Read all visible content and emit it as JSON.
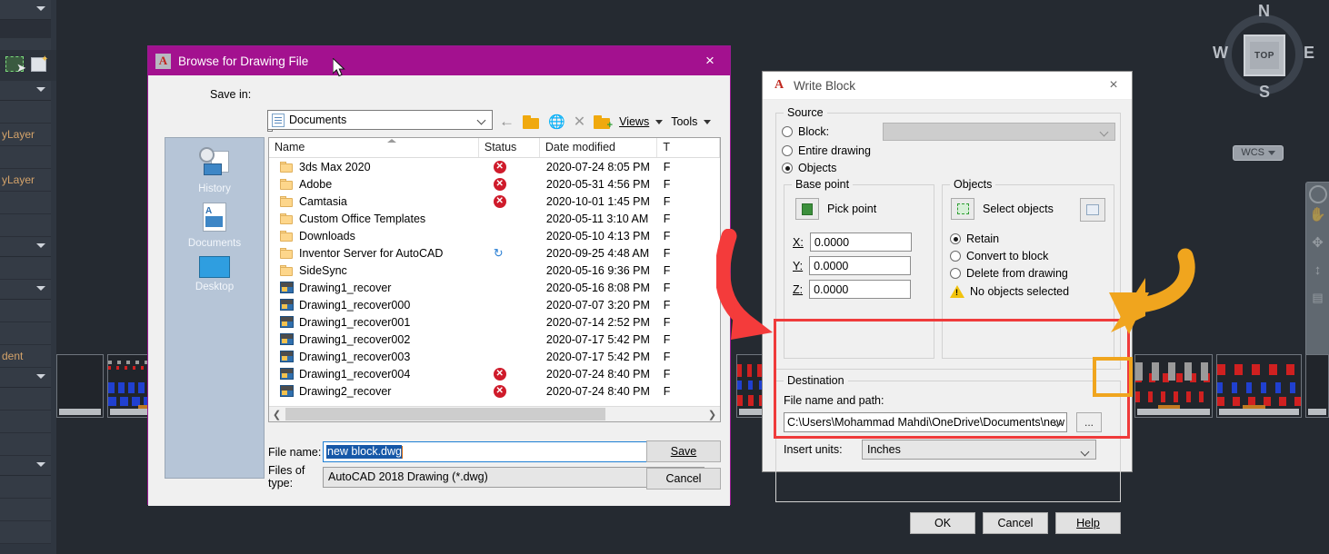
{
  "app": {
    "viewcube": {
      "top_label": "TOP",
      "north": "N",
      "south": "S",
      "west": "W",
      "east": "E",
      "ucs_label": "WCS"
    },
    "left_palette": {
      "bylayer_1": "yLayer",
      "bylayer_2": "yLayer",
      "dent_text": "dent"
    }
  },
  "browse_dialog": {
    "title": "Browse for Drawing File",
    "close_label": "×",
    "save_in_label": "Save in:",
    "save_in_value": "Documents",
    "toolbar": {
      "back_label": "back-arrow",
      "up_folder_label": "up-one-level",
      "search_web_label": "search-the-web",
      "delete_label": "delete",
      "new_folder_label": "create-new-folder",
      "views_label": "Views",
      "tools_label": "Tools"
    },
    "places": [
      {
        "label": "History",
        "icon": "history-icon"
      },
      {
        "label": "Documents",
        "icon": "documents-icon"
      },
      {
        "label": "Desktop",
        "icon": "desktop-icon"
      }
    ],
    "columns": [
      "Name",
      "Status",
      "Date modified",
      "T"
    ],
    "files": [
      {
        "name": "3ds Max 2020",
        "kind": "folder",
        "status": "error",
        "date": "2020-07-24 8:05 PM"
      },
      {
        "name": "Adobe",
        "kind": "folder",
        "status": "error",
        "date": "2020-05-31 4:56 PM"
      },
      {
        "name": "Camtasia",
        "kind": "folder",
        "status": "error",
        "date": "2020-10-01 1:45 PM"
      },
      {
        "name": "Custom Office Templates",
        "kind": "folder",
        "status": "",
        "date": "2020-05-11 3:10 AM"
      },
      {
        "name": "Downloads",
        "kind": "folder",
        "status": "",
        "date": "2020-05-10 4:13 PM"
      },
      {
        "name": "Inventor Server for AutoCAD",
        "kind": "folder",
        "status": "sync",
        "date": "2020-09-25 4:48 AM"
      },
      {
        "name": "SideSync",
        "kind": "folder",
        "status": "",
        "date": "2020-05-16 9:36 PM"
      },
      {
        "name": "Drawing1_recover",
        "kind": "drawing",
        "status": "",
        "date": "2020-05-16 8:08 PM"
      },
      {
        "name": "Drawing1_recover000",
        "kind": "drawing",
        "status": "",
        "date": "2020-07-07 3:20 PM"
      },
      {
        "name": "Drawing1_recover001",
        "kind": "drawing",
        "status": "",
        "date": "2020-07-14 2:52 PM"
      },
      {
        "name": "Drawing1_recover002",
        "kind": "drawing",
        "status": "",
        "date": "2020-07-17 5:42 PM"
      },
      {
        "name": "Drawing1_recover003",
        "kind": "drawing",
        "status": "",
        "date": "2020-07-17 5:42 PM"
      },
      {
        "name": "Drawing1_recover004",
        "kind": "drawing",
        "status": "error",
        "date": "2020-07-24 8:40 PM"
      },
      {
        "name": "Drawing2_recover",
        "kind": "drawing",
        "status": "error",
        "date": "2020-07-24 8:40 PM"
      }
    ],
    "file_name_label": "File name:",
    "file_name_value": "new block.dwg",
    "files_of_type_label": "Files of type:",
    "files_of_type_value": "AutoCAD 2018 Drawing (*.dwg)",
    "save_button": "Save",
    "cancel_button": "Cancel"
  },
  "write_block_dialog": {
    "title": "Write Block",
    "close_label": "×",
    "source": {
      "legend": "Source",
      "block_label": "Block:",
      "block_value": "",
      "entire_drawing_label": "Entire drawing",
      "objects_label": "Objects",
      "selected": "Objects"
    },
    "base_point": {
      "legend": "Base point",
      "pick_point_label": "Pick point",
      "x_label": "X:",
      "x_value": "0.0000",
      "y_label": "Y:",
      "y_value": "0.0000",
      "z_label": "Z:",
      "z_value": "0.0000"
    },
    "objects": {
      "legend": "Objects",
      "select_objects_label": "Select objects",
      "quick_select_label": "quick-select",
      "retain_label": "Retain",
      "convert_label": "Convert to block",
      "delete_label": "Delete from drawing",
      "selected": "Retain",
      "status_text": "No objects selected"
    },
    "destination": {
      "legend": "Destination",
      "file_name_path_label": "File name and path:",
      "file_name_path_value": "C:\\Users\\Mohammad Mahdi\\OneDrive\\Documents\\new block",
      "browse_button_label": "...",
      "insert_units_label": "Insert units:",
      "insert_units_value": "Inches"
    },
    "buttons": {
      "ok": "OK",
      "cancel": "Cancel",
      "help": "Help"
    }
  },
  "annotations": {
    "red_highlight_color": "#ef3b3b",
    "orange_highlight_color": "#f0a51e",
    "red_arrow_target": "Destination group",
    "orange_arrow_target": "browse ellipsis button"
  },
  "colors": {
    "browse_titlebar": "#a3118f",
    "dialog_face": "#f0f0f0",
    "canvas": "#252a31",
    "selection_blue": "#1658a8",
    "status_error": "#cf1b2b",
    "status_sync": "#2a7fd4"
  }
}
